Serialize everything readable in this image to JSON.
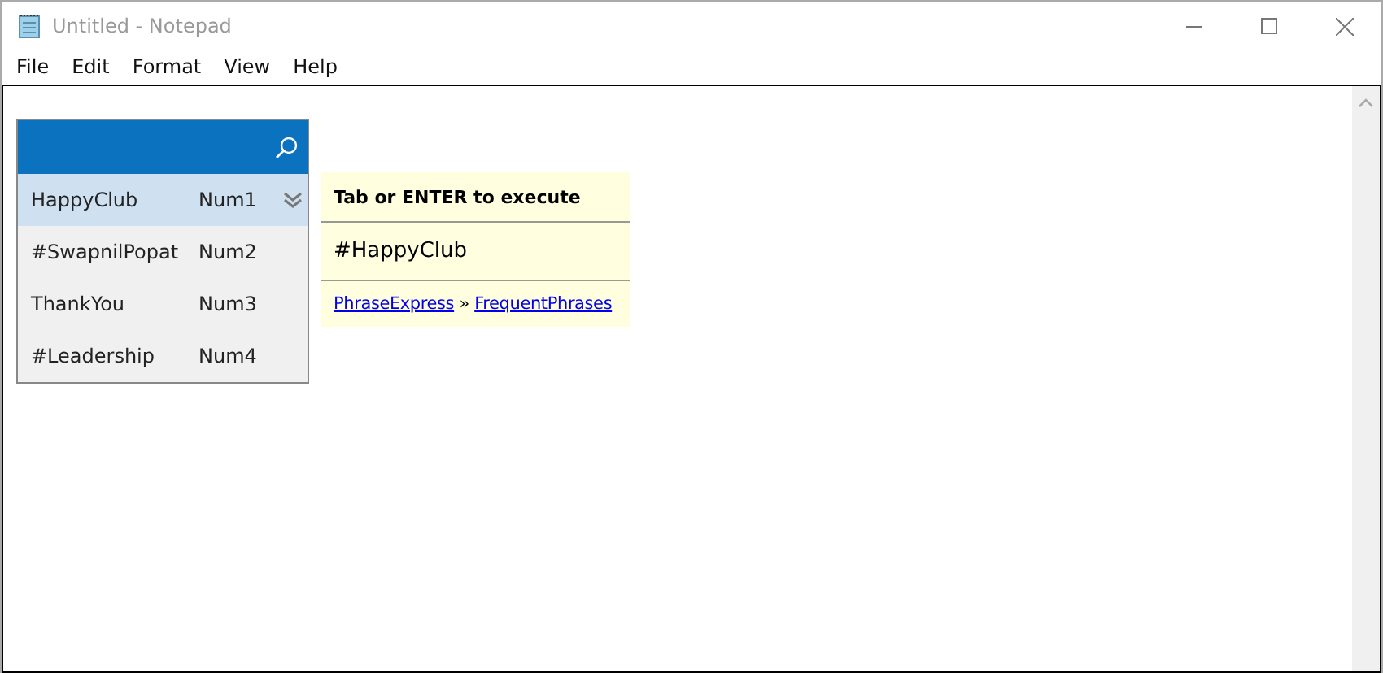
{
  "window": {
    "title": "Untitled - Notepad"
  },
  "menu": [
    "File",
    "Edit",
    "Format",
    "View",
    "Help"
  ],
  "popup": {
    "rows": [
      {
        "phrase": "HappyClub",
        "hotkey": "Num1",
        "selected": true
      },
      {
        "phrase": "#SwapnilPopat",
        "hotkey": "Num2",
        "selected": false
      },
      {
        "phrase": "ThankYou",
        "hotkey": "Num3",
        "selected": false
      },
      {
        "phrase": "#Leadership",
        "hotkey": "Num4",
        "selected": false
      }
    ]
  },
  "tooltip": {
    "hint": "Tab or ENTER to execute",
    "preview": "#HappyClub",
    "path": [
      "PhraseExpress",
      "FrequentPhrases"
    ],
    "separator": "»"
  }
}
